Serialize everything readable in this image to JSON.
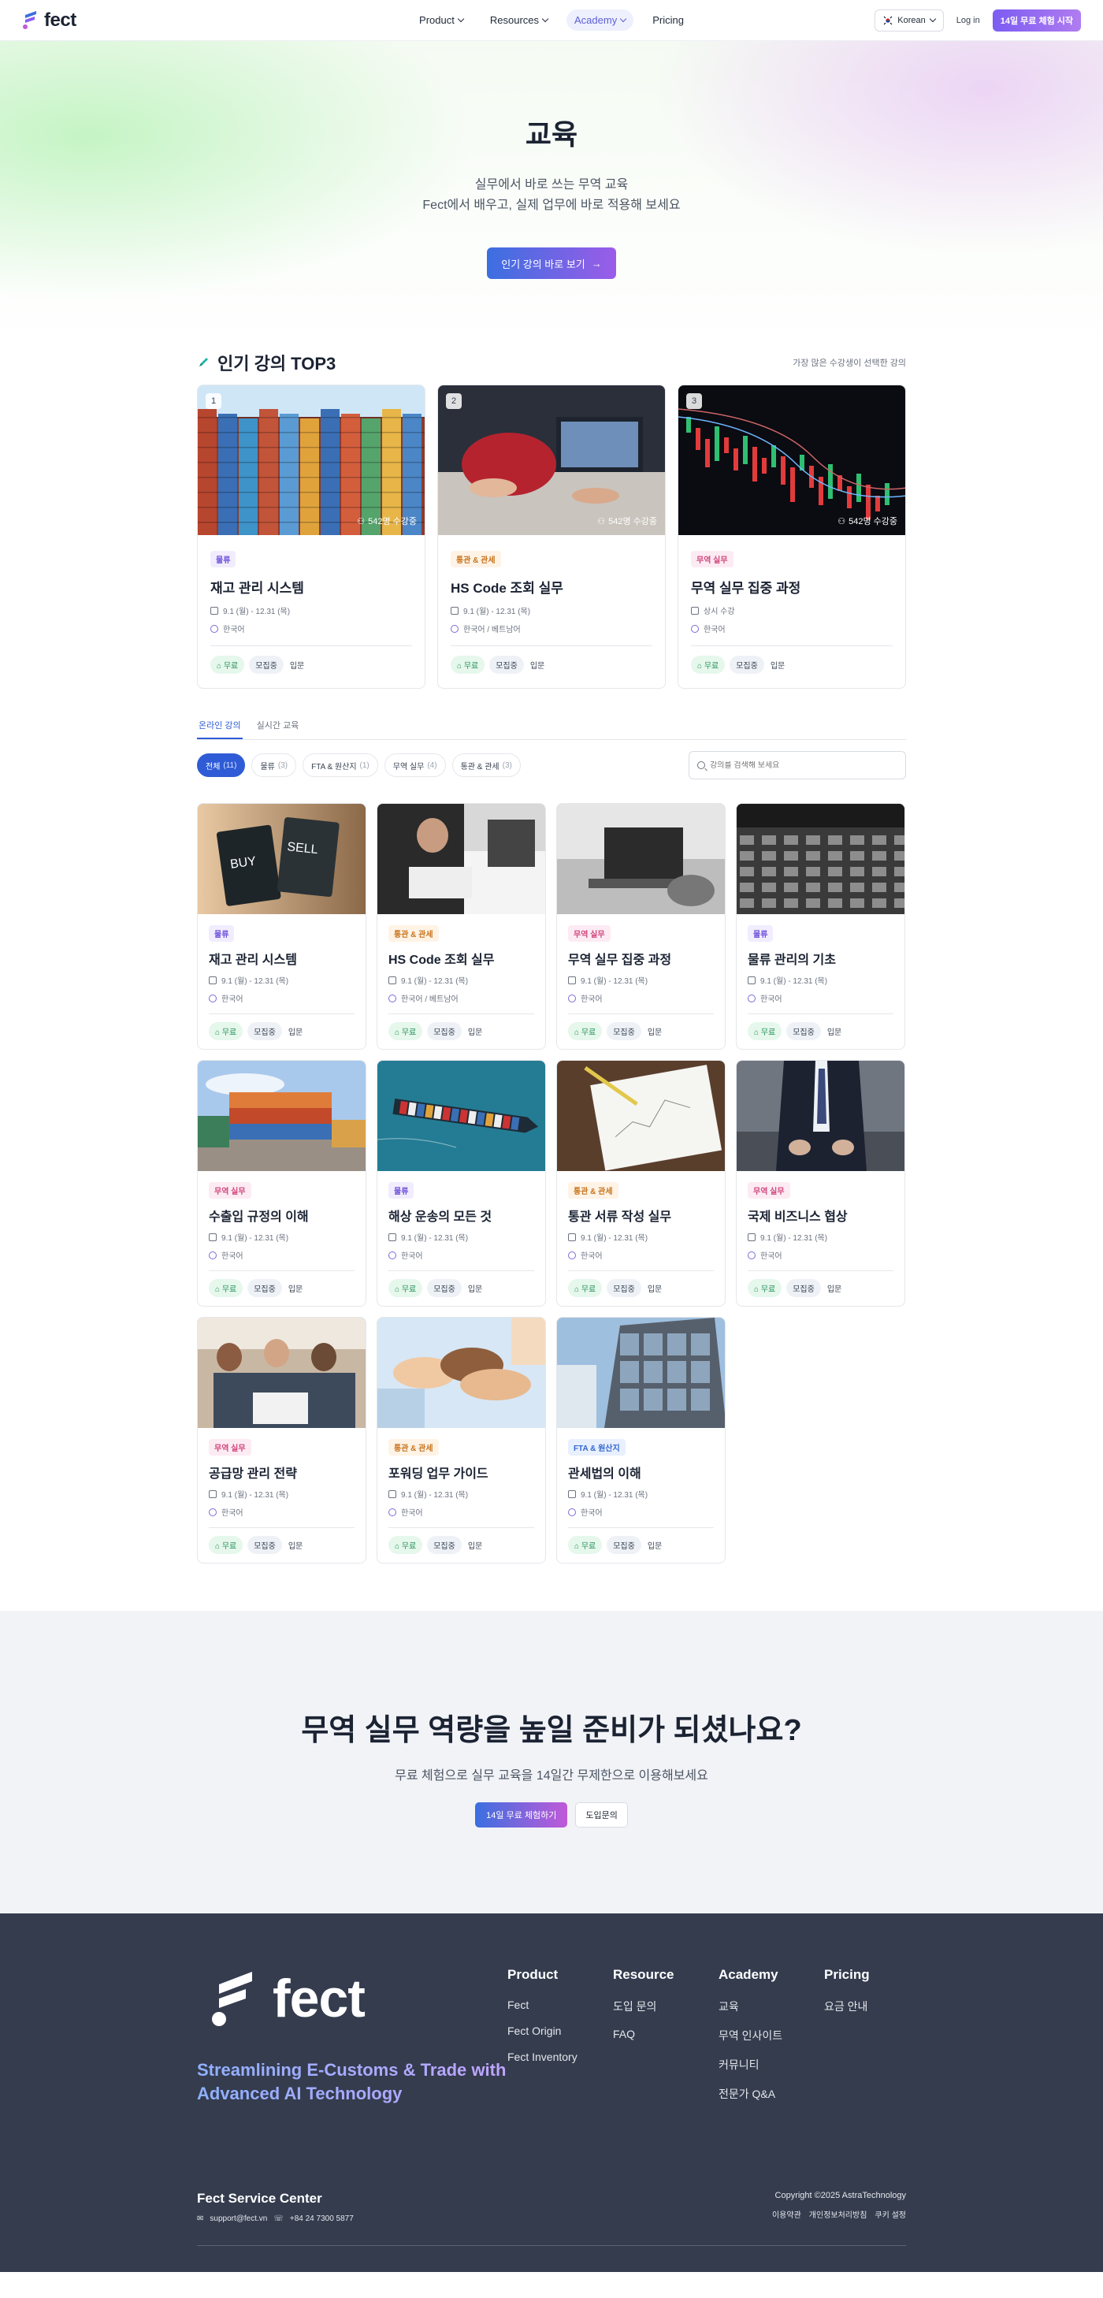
{
  "nav": {
    "brand": "fect",
    "items": [
      {
        "label": "Product",
        "has_menu": true,
        "active": false
      },
      {
        "label": "Resources",
        "has_menu": true,
        "active": false
      },
      {
        "label": "Academy",
        "has_menu": true,
        "active": true
      },
      {
        "label": "Pricing",
        "has_menu": false,
        "active": false
      }
    ],
    "language": "Korean",
    "login": "Log in",
    "trial": "14일 무료 체험 시작"
  },
  "hero": {
    "title": "교육",
    "subtitle1": "실무에서 바로 쓰는 무역 교육",
    "subtitle2": "Fect에서 배우고, 실제 업무에 바로 적용해 보세요",
    "button": "인기 강의 바로 보기"
  },
  "top3": {
    "title": "인기 강의 TOP3",
    "note": "가장 많은 수강생이 선택한 강의",
    "courses": [
      {
        "rank": "1",
        "views": "542명 수강중",
        "category": "물류",
        "cat_class": "logistics",
        "title": "재고 관리 시스템",
        "date": "9.1 (월) - 12.31 (목)",
        "lang": "한국어",
        "tags": [
          "무료",
          "모집중",
          "입문"
        ],
        "image": "containers"
      },
      {
        "rank": "2",
        "views": "542명 수강중",
        "category": "통관 & 관세",
        "cat_class": "customs",
        "title": "HS Code 조회 실무",
        "date": "9.1 (월) - 12.31 (목)",
        "lang": "한국어 / 베트남어",
        "tags": [
          "무료",
          "모집중",
          "입문"
        ],
        "image": "laptop"
      },
      {
        "rank": "3",
        "views": "542명 수강중",
        "category": "무역 실무",
        "cat_class": "trade",
        "title": "무역 실무 집중 과정",
        "date": "상시 수강",
        "lang": "한국어",
        "tags": [
          "무료",
          "모집중",
          "입문"
        ],
        "image": "candles"
      }
    ]
  },
  "tabs": {
    "online": "온라인 강의",
    "live": "실시간 교육"
  },
  "filters": [
    {
      "label": "전체",
      "count": "(11)",
      "active": true
    },
    {
      "label": "물류",
      "count": "(3)",
      "active": false
    },
    {
      "label": "FTA & 원산지",
      "count": "(1)",
      "active": false
    },
    {
      "label": "무역 실무",
      "count": "(4)",
      "active": false
    },
    {
      "label": "통관 & 관세",
      "count": "(3)",
      "active": false
    }
  ],
  "search": {
    "placeholder": "강의를 검색해 보세요"
  },
  "courses": [
    {
      "category": "물류",
      "cat_class": "logistics",
      "title": "재고 관리 시스템",
      "date": "9.1 (월) - 12.31 (목)",
      "lang": "한국어",
      "tags": [
        "무료",
        "모집중",
        "입문"
      ],
      "image": "buysell"
    },
    {
      "category": "통관 & 관세",
      "cat_class": "customs",
      "title": "HS Code 조회 실무",
      "date": "9.1 (월) - 12.31 (목)",
      "lang": "한국어 / 베트남어",
      "tags": [
        "무료",
        "모집중",
        "입문"
      ],
      "image": "meeting"
    },
    {
      "category": "무역 실무",
      "cat_class": "trade",
      "title": "무역 실무 집중 과정",
      "date": "9.1 (월) - 12.31 (목)",
      "lang": "한국어",
      "tags": [
        "무료",
        "모집중",
        "입문"
      ],
      "image": "bwlaptop"
    },
    {
      "category": "물류",
      "cat_class": "logistics",
      "title": "물류 관리의 기초",
      "date": "9.1 (월) - 12.31 (목)",
      "lang": "한국어",
      "tags": [
        "무료",
        "모집중",
        "입문"
      ],
      "image": "office"
    },
    {
      "category": "무역 실무",
      "cat_class": "trade",
      "title": "수출입 규정의 이해",
      "date": "9.1 (월) - 12.31 (목)",
      "lang": "한국어",
      "tags": [
        "무료",
        "모집중",
        "입문"
      ],
      "image": "stack"
    },
    {
      "category": "물류",
      "cat_class": "logistics",
      "title": "해상 운송의 모든 것",
      "date": "9.1 (월) - 12.31 (목)",
      "lang": "한국어",
      "tags": [
        "무료",
        "모집중",
        "입문"
      ],
      "image": "ship"
    },
    {
      "category": "통관 & 관세",
      "cat_class": "customs",
      "title": "통관 서류 작성 실무",
      "date": "9.1 (월) - 12.31 (목)",
      "lang": "한국어",
      "tags": [
        "무료",
        "모집중",
        "입문"
      ],
      "image": "paper"
    },
    {
      "category": "무역 실무",
      "cat_class": "trade",
      "title": "국제 비즈니스 협상",
      "date": "9.1 (월) - 12.31 (목)",
      "lang": "한국어",
      "tags": [
        "무료",
        "모집중",
        "입문"
      ],
      "image": "suit"
    },
    {
      "category": "무역 실무",
      "cat_class": "trade",
      "title": "공급망 관리 전략",
      "date": "9.1 (월) - 12.31 (목)",
      "lang": "한국어",
      "tags": [
        "무료",
        "모집중",
        "입문"
      ],
      "image": "team"
    },
    {
      "category": "통관 & 관세",
      "cat_class": "customs",
      "title": "포워딩 업무 가이드",
      "date": "9.1 (월) - 12.31 (목)",
      "lang": "한국어",
      "tags": [
        "무료",
        "모집중",
        "입문"
      ],
      "image": "hands"
    },
    {
      "category": "FTA & 원산지",
      "cat_class": "fta",
      "title": "관세법의 이해",
      "date": "9.1 (월) - 12.31 (목)",
      "lang": "한국어",
      "tags": [
        "무료",
        "모집중",
        "입문"
      ],
      "image": "building"
    }
  ],
  "cta": {
    "title": "무역 실무 역량을 높일 준비가 되셨나요?",
    "subtitle": "무료 체험으로 실무 교육을 14일간 무제한으로 이용해보세요",
    "primary": "14일 무료 체험하기",
    "secondary": "도입문의"
  },
  "footer": {
    "brand": "fect",
    "tagline": "Streamlining E-Customs & Trade with Advanced AI Technology",
    "columns": [
      {
        "title": "Product",
        "links": [
          "Fect",
          "Fect Origin",
          "Fect Inventory"
        ]
      },
      {
        "title": "Resource",
        "links": [
          "도입 문의",
          "FAQ"
        ]
      },
      {
        "title": "Academy",
        "links": [
          "교육",
          "무역 인사이트",
          "커뮤니티",
          "전문가 Q&A"
        ]
      },
      {
        "title": "Pricing",
        "links": [
          "요금 안내"
        ]
      }
    ],
    "service_title": "Fect Service Center",
    "email": "support@fect.vn",
    "phone": "+84 24 7300 5877",
    "copyright": "Copyright ©2025 AstraTechnology",
    "legal": [
      "이용약관",
      "개인정보처리방침",
      "쿠키 설정"
    ]
  }
}
